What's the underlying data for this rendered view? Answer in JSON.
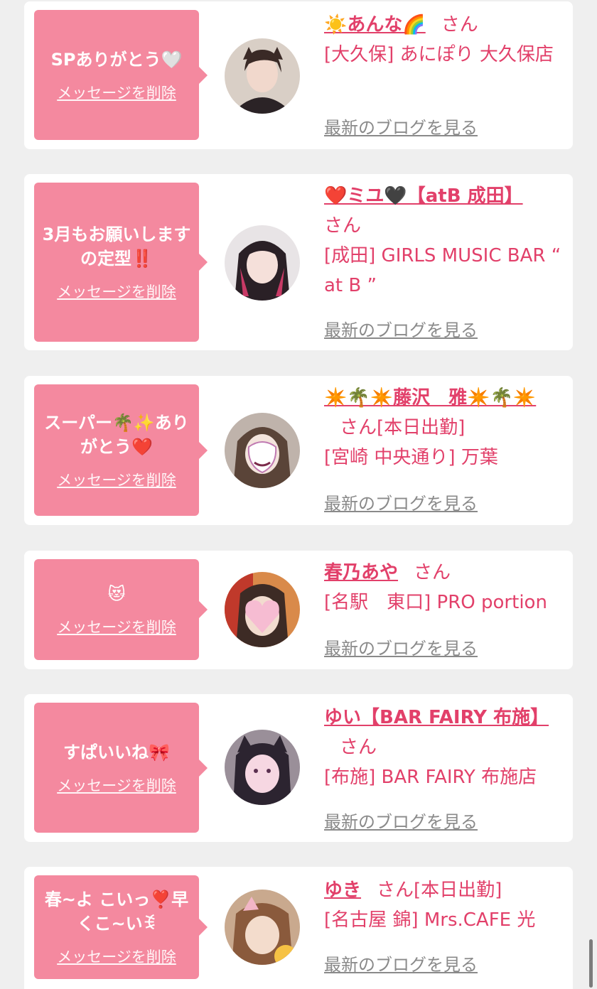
{
  "delete_label": "メッセージを削除",
  "blog_label": "最新のブログを見る",
  "honorific": "さん",
  "cards": [
    {
      "message": "SPありがとう🤍",
      "name": "☀️あんな🌈",
      "status": "",
      "shop": "[大久保] あにぽり 大久保店"
    },
    {
      "message": "3月もお願いしますの定型‼️",
      "name": "❤️ミユ🖤【atB 成田】",
      "status": "",
      "shop": "[成田] GIRLS MUSIC BAR “ at B ”"
    },
    {
      "message": "スーパー🌴✨ありがとう❤️",
      "name": "✴️🌴✴️藤沢　雅✴️🌴✴️",
      "status": "[本日出勤]",
      "shop": "[宮崎 中央通り] 万葉"
    },
    {
      "message": "😻",
      "name": "春乃あや",
      "status": "",
      "shop": "[名駅　東口] PRO portion"
    },
    {
      "message": "すぱいいね🎀",
      "name": "ゆい【BAR FAIRY 布施】",
      "status": "",
      "shop": "[布施] BAR FAIRY 布施店"
    },
    {
      "message": "春~よ こいっ❣️早くこ~いꉂ",
      "name": "ゆき",
      "status": "[本日出勤]",
      "shop": "[名古屋 錦] Mrs.CAFE 光"
    }
  ]
}
